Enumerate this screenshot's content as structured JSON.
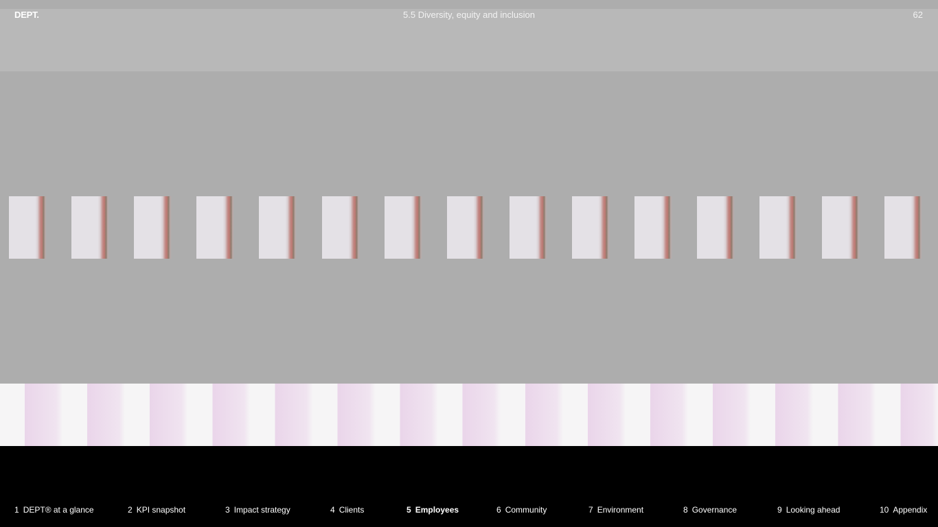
{
  "header": {
    "logo": "DEPT.",
    "section_title": "5.5 Diversity, equity and inclusion",
    "page_number": "62"
  },
  "nav": {
    "items": [
      {
        "num": "1",
        "label": "DEPT® at a glance"
      },
      {
        "num": "2",
        "label": "KPI snapshot"
      },
      {
        "num": "3",
        "label": "Impact strategy"
      },
      {
        "num": "4",
        "label": "Clients"
      },
      {
        "num": "5",
        "label": "Employees"
      },
      {
        "num": "6",
        "label": "Community"
      },
      {
        "num": "7",
        "label": "Environment"
      },
      {
        "num": "8",
        "label": "Governance"
      },
      {
        "num": "9",
        "label": "Looking ahead"
      },
      {
        "num": "10",
        "label": "Appendix"
      }
    ],
    "active_index": 4
  },
  "colors": {
    "header_band": "#b8b8b8",
    "canvas": "#adadad",
    "footer": "#000000",
    "text": "#ffffff"
  }
}
